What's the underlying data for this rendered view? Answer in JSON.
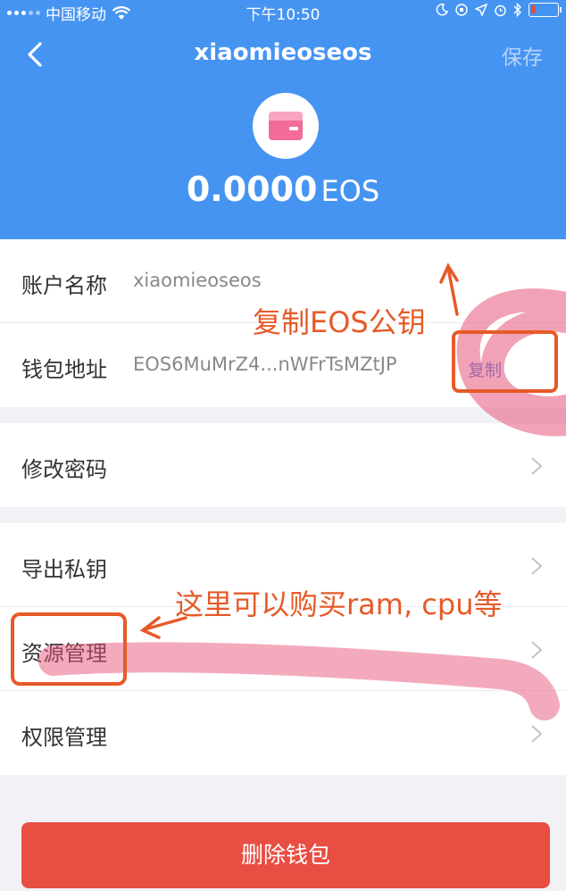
{
  "status_bar": {
    "carrier": "中国移动",
    "time": "下午10:50"
  },
  "nav": {
    "title": "xiaomieoseos",
    "save_label": "保存"
  },
  "wallet": {
    "balance": "0.0000",
    "unit": "EOS"
  },
  "account_section": {
    "account_label": "账户名称",
    "account_value": "xiaomieoseos",
    "address_label": "钱包地址",
    "address_value": "EOS6MuMrZ4...nWFrTsMZtJP",
    "copy_label": "复制"
  },
  "menu": {
    "change_password": "修改密码",
    "export_private_key": "导出私钥",
    "resource_management": "资源管理",
    "permission_management": "权限管理"
  },
  "delete_label": "删除钱包",
  "annotations": {
    "copy_note": "复制EOS公钥",
    "resource_note": "这里可以购买ram, cpu等"
  },
  "colors": {
    "header_blue": "#4694f2",
    "delete_red": "#e94e42",
    "annotation_orange": "#e65a28",
    "highlight_pink": "#e8567a"
  },
  "battery_level": 0.2
}
